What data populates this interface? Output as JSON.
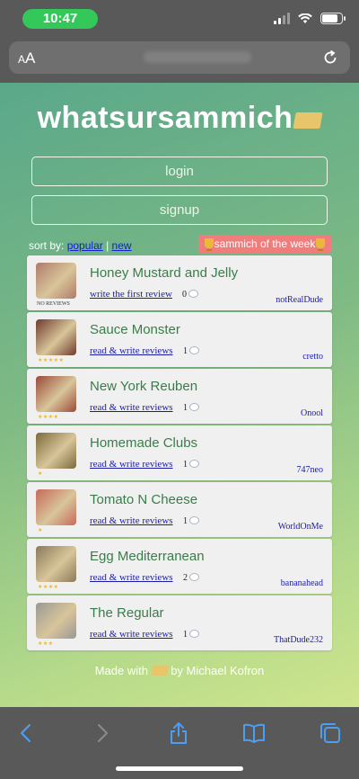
{
  "status": {
    "time": "10:47"
  },
  "browser": {
    "aa_label_small": "A",
    "aa_label_large": "A"
  },
  "site": {
    "logo": "whatsursammich",
    "login_label": "login",
    "signup_label": "signup",
    "sort_label": "sort by:",
    "sort_popular": "popular",
    "sort_separator": "|",
    "sort_new": "new",
    "sotw_label": "sammich of the week",
    "footer_prefix": "Made with",
    "footer_suffix": "by Michael Kofron"
  },
  "sammiches": [
    {
      "title": "Honey Mustard and Jelly",
      "link": "write the first review",
      "count": "0",
      "author": "notRealDude",
      "rating_text": "NO REVIEWS",
      "stars": 0,
      "thumb_color": "#b07a6a"
    },
    {
      "title": "Sauce Monster",
      "link": "read & write reviews",
      "count": "1",
      "author": "cretto",
      "stars": 5,
      "thumb_color": "#6e3a2c"
    },
    {
      "title": "New York Reuben",
      "link": "read & write reviews",
      "count": "1",
      "author": "Onool",
      "stars": 4,
      "thumb_color": "#9a4a3a"
    },
    {
      "title": "Homemade Clubs",
      "link": "read & write reviews",
      "count": "1",
      "author": "747neo",
      "stars": 1,
      "thumb_color": "#7b6a3a"
    },
    {
      "title": "Tomato N Cheese",
      "link": "read & write reviews",
      "count": "1",
      "author": "WorldOnMe",
      "stars": 1,
      "thumb_color": "#c86a5a"
    },
    {
      "title": "Egg Mediterranean",
      "link": "read & write reviews",
      "count": "2",
      "author": "bananahead",
      "stars": 4,
      "thumb_color": "#8a7a5a"
    },
    {
      "title": "The Regular",
      "link": "read & write reviews",
      "count": "1",
      "author": "ThatDude232",
      "stars": 3,
      "thumb_color": "#9a9896"
    }
  ],
  "colors": {
    "accent": "#3a7d4a",
    "link": "#1a1aa8",
    "sotw_bg": "#f17c7c",
    "star": "#f1b81d"
  }
}
